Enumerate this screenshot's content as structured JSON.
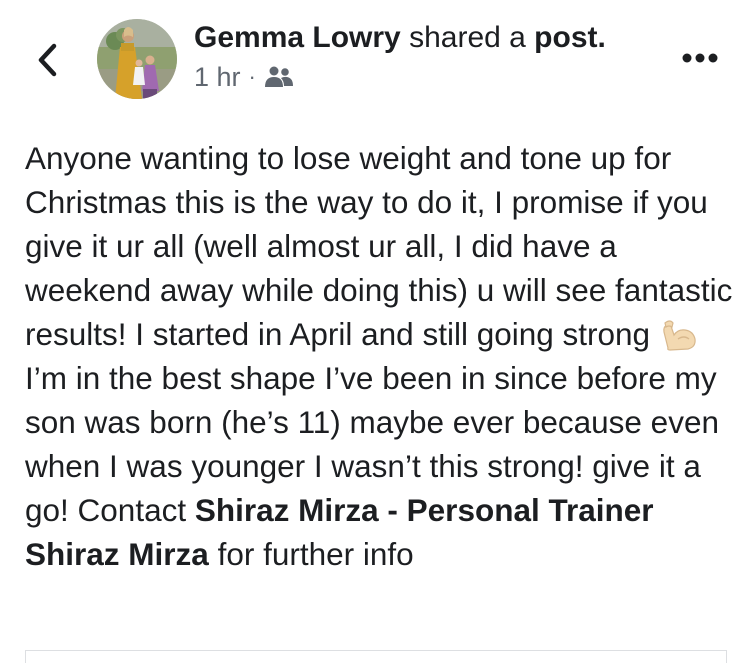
{
  "header": {
    "author_name": "Gemma Lowry",
    "action_text": "shared a",
    "object_text": "post.",
    "timestamp": "1 hr",
    "separator": "·",
    "audience_icon": "friends-icon",
    "back_icon": "chevron-left-icon",
    "more_icon": "more-horizontal-icon"
  },
  "post": {
    "text_1": "Anyone wanting to lose weight and tone up for Christmas this is the way to do it, I promise if you give it ur all (well almost ur all, I did have a weekend away while doing this) u will see fantastic results! I started in April and still going strong",
    "emoji_name": "flexed-biceps-emoji",
    "text_2": " I’m in the best shape I’ve been in since before my son was born (he’s 11) maybe ever because even when I was younger I wasn’t this strong! give it a go! Contact ",
    "mention_1": "Shiraz Mirza - Personal Trainer",
    "mention_2": "Shiraz Mirza",
    "text_3": " for further info"
  },
  "colors": {
    "text_primary": "#1c1e21",
    "text_secondary": "#606770",
    "border": "#dddfe2"
  }
}
